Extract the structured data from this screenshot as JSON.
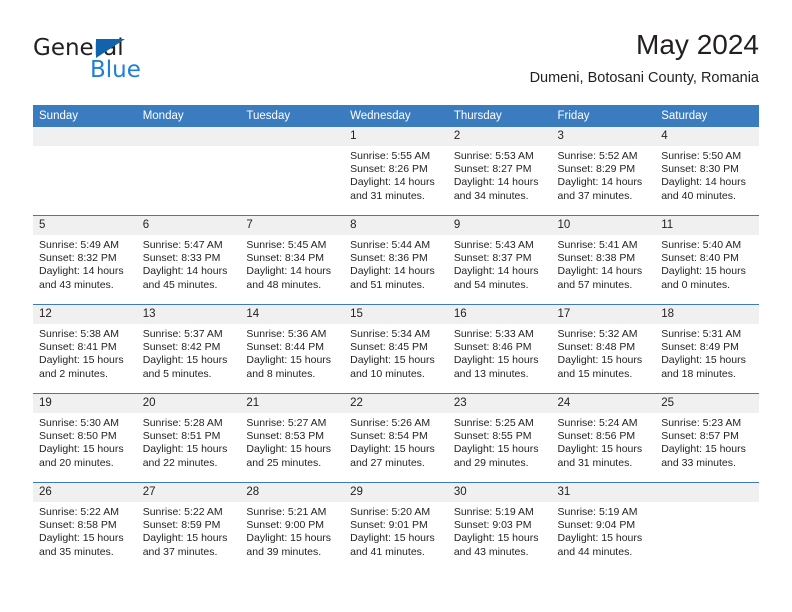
{
  "brand": {
    "name_dark": "General",
    "name_light": "Blue",
    "triangle_color": "#1263AD",
    "blue_color": "#1F7FD4"
  },
  "header": {
    "title": "May 2024",
    "location": "Dumeni, Botosani County, Romania"
  },
  "theme": {
    "header_blue": "#3B7CC0",
    "date_strip_gray": "#F0F0F0",
    "text": "#231F20"
  },
  "calendar": {
    "weekday_headers": [
      "Sunday",
      "Monday",
      "Tuesday",
      "Wednesday",
      "Thursday",
      "Friday",
      "Saturday"
    ],
    "weeks": [
      [
        {
          "day": "",
          "sunrise": "",
          "sunset": "",
          "daylight_line1": "",
          "daylight_line2": ""
        },
        {
          "day": "",
          "sunrise": "",
          "sunset": "",
          "daylight_line1": "",
          "daylight_line2": ""
        },
        {
          "day": "",
          "sunrise": "",
          "sunset": "",
          "daylight_line1": "",
          "daylight_line2": ""
        },
        {
          "day": "1",
          "sunrise": "Sunrise: 5:55 AM",
          "sunset": "Sunset: 8:26 PM",
          "daylight_line1": "Daylight: 14 hours",
          "daylight_line2": "and 31 minutes."
        },
        {
          "day": "2",
          "sunrise": "Sunrise: 5:53 AM",
          "sunset": "Sunset: 8:27 PM",
          "daylight_line1": "Daylight: 14 hours",
          "daylight_line2": "and 34 minutes."
        },
        {
          "day": "3",
          "sunrise": "Sunrise: 5:52 AM",
          "sunset": "Sunset: 8:29 PM",
          "daylight_line1": "Daylight: 14 hours",
          "daylight_line2": "and 37 minutes."
        },
        {
          "day": "4",
          "sunrise": "Sunrise: 5:50 AM",
          "sunset": "Sunset: 8:30 PM",
          "daylight_line1": "Daylight: 14 hours",
          "daylight_line2": "and 40 minutes."
        }
      ],
      [
        {
          "day": "5",
          "sunrise": "Sunrise: 5:49 AM",
          "sunset": "Sunset: 8:32 PM",
          "daylight_line1": "Daylight: 14 hours",
          "daylight_line2": "and 43 minutes."
        },
        {
          "day": "6",
          "sunrise": "Sunrise: 5:47 AM",
          "sunset": "Sunset: 8:33 PM",
          "daylight_line1": "Daylight: 14 hours",
          "daylight_line2": "and 45 minutes."
        },
        {
          "day": "7",
          "sunrise": "Sunrise: 5:45 AM",
          "sunset": "Sunset: 8:34 PM",
          "daylight_line1": "Daylight: 14 hours",
          "daylight_line2": "and 48 minutes."
        },
        {
          "day": "8",
          "sunrise": "Sunrise: 5:44 AM",
          "sunset": "Sunset: 8:36 PM",
          "daylight_line1": "Daylight: 14 hours",
          "daylight_line2": "and 51 minutes."
        },
        {
          "day": "9",
          "sunrise": "Sunrise: 5:43 AM",
          "sunset": "Sunset: 8:37 PM",
          "daylight_line1": "Daylight: 14 hours",
          "daylight_line2": "and 54 minutes."
        },
        {
          "day": "10",
          "sunrise": "Sunrise: 5:41 AM",
          "sunset": "Sunset: 8:38 PM",
          "daylight_line1": "Daylight: 14 hours",
          "daylight_line2": "and 57 minutes."
        },
        {
          "day": "11",
          "sunrise": "Sunrise: 5:40 AM",
          "sunset": "Sunset: 8:40 PM",
          "daylight_line1": "Daylight: 15 hours",
          "daylight_line2": "and 0 minutes."
        }
      ],
      [
        {
          "day": "12",
          "sunrise": "Sunrise: 5:38 AM",
          "sunset": "Sunset: 8:41 PM",
          "daylight_line1": "Daylight: 15 hours",
          "daylight_line2": "and 2 minutes."
        },
        {
          "day": "13",
          "sunrise": "Sunrise: 5:37 AM",
          "sunset": "Sunset: 8:42 PM",
          "daylight_line1": "Daylight: 15 hours",
          "daylight_line2": "and 5 minutes."
        },
        {
          "day": "14",
          "sunrise": "Sunrise: 5:36 AM",
          "sunset": "Sunset: 8:44 PM",
          "daylight_line1": "Daylight: 15 hours",
          "daylight_line2": "and 8 minutes."
        },
        {
          "day": "15",
          "sunrise": "Sunrise: 5:34 AM",
          "sunset": "Sunset: 8:45 PM",
          "daylight_line1": "Daylight: 15 hours",
          "daylight_line2": "and 10 minutes."
        },
        {
          "day": "16",
          "sunrise": "Sunrise: 5:33 AM",
          "sunset": "Sunset: 8:46 PM",
          "daylight_line1": "Daylight: 15 hours",
          "daylight_line2": "and 13 minutes."
        },
        {
          "day": "17",
          "sunrise": "Sunrise: 5:32 AM",
          "sunset": "Sunset: 8:48 PM",
          "daylight_line1": "Daylight: 15 hours",
          "daylight_line2": "and 15 minutes."
        },
        {
          "day": "18",
          "sunrise": "Sunrise: 5:31 AM",
          "sunset": "Sunset: 8:49 PM",
          "daylight_line1": "Daylight: 15 hours",
          "daylight_line2": "and 18 minutes."
        }
      ],
      [
        {
          "day": "19",
          "sunrise": "Sunrise: 5:30 AM",
          "sunset": "Sunset: 8:50 PM",
          "daylight_line1": "Daylight: 15 hours",
          "daylight_line2": "and 20 minutes."
        },
        {
          "day": "20",
          "sunrise": "Sunrise: 5:28 AM",
          "sunset": "Sunset: 8:51 PM",
          "daylight_line1": "Daylight: 15 hours",
          "daylight_line2": "and 22 minutes."
        },
        {
          "day": "21",
          "sunrise": "Sunrise: 5:27 AM",
          "sunset": "Sunset: 8:53 PM",
          "daylight_line1": "Daylight: 15 hours",
          "daylight_line2": "and 25 minutes."
        },
        {
          "day": "22",
          "sunrise": "Sunrise: 5:26 AM",
          "sunset": "Sunset: 8:54 PM",
          "daylight_line1": "Daylight: 15 hours",
          "daylight_line2": "and 27 minutes."
        },
        {
          "day": "23",
          "sunrise": "Sunrise: 5:25 AM",
          "sunset": "Sunset: 8:55 PM",
          "daylight_line1": "Daylight: 15 hours",
          "daylight_line2": "and 29 minutes."
        },
        {
          "day": "24",
          "sunrise": "Sunrise: 5:24 AM",
          "sunset": "Sunset: 8:56 PM",
          "daylight_line1": "Daylight: 15 hours",
          "daylight_line2": "and 31 minutes."
        },
        {
          "day": "25",
          "sunrise": "Sunrise: 5:23 AM",
          "sunset": "Sunset: 8:57 PM",
          "daylight_line1": "Daylight: 15 hours",
          "daylight_line2": "and 33 minutes."
        }
      ],
      [
        {
          "day": "26",
          "sunrise": "Sunrise: 5:22 AM",
          "sunset": "Sunset: 8:58 PM",
          "daylight_line1": "Daylight: 15 hours",
          "daylight_line2": "and 35 minutes."
        },
        {
          "day": "27",
          "sunrise": "Sunrise: 5:22 AM",
          "sunset": "Sunset: 8:59 PM",
          "daylight_line1": "Daylight: 15 hours",
          "daylight_line2": "and 37 minutes."
        },
        {
          "day": "28",
          "sunrise": "Sunrise: 5:21 AM",
          "sunset": "Sunset: 9:00 PM",
          "daylight_line1": "Daylight: 15 hours",
          "daylight_line2": "and 39 minutes."
        },
        {
          "day": "29",
          "sunrise": "Sunrise: 5:20 AM",
          "sunset": "Sunset: 9:01 PM",
          "daylight_line1": "Daylight: 15 hours",
          "daylight_line2": "and 41 minutes."
        },
        {
          "day": "30",
          "sunrise": "Sunrise: 5:19 AM",
          "sunset": "Sunset: 9:03 PM",
          "daylight_line1": "Daylight: 15 hours",
          "daylight_line2": "and 43 minutes."
        },
        {
          "day": "31",
          "sunrise": "Sunrise: 5:19 AM",
          "sunset": "Sunset: 9:04 PM",
          "daylight_line1": "Daylight: 15 hours",
          "daylight_line2": "and 44 minutes."
        },
        {
          "day": "",
          "sunrise": "",
          "sunset": "",
          "daylight_line1": "",
          "daylight_line2": ""
        }
      ]
    ]
  }
}
